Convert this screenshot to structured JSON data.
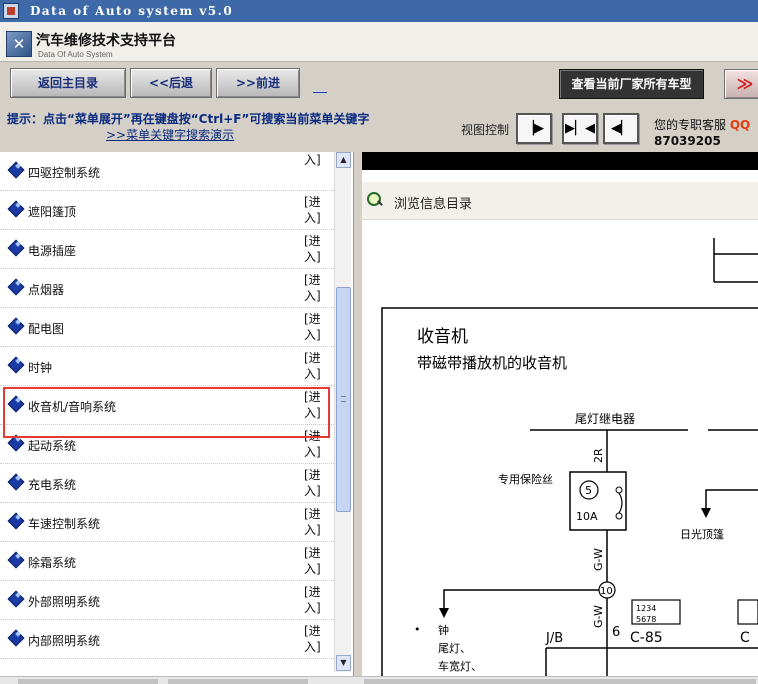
{
  "window": {
    "title": "Data of Auto system v5.0"
  },
  "brand": {
    "name": "汽车维修技术支持平台",
    "subtitle": "Data Of Auto System"
  },
  "toolbar": {
    "home": "返回主目录",
    "back": "<<后退",
    "forward": ">>前进",
    "all_models": "查看当前厂家所有车型",
    "more": "≫"
  },
  "tip": {
    "line1": "提示：点击“菜单展开”再在键盘按“Ctrl+F”可搜索当前菜单关键字",
    "line2": ">>菜单关键字搜索演示",
    "view_label": "视图控制",
    "support_label": "您的专职客服",
    "support_qq": "QQ",
    "support_phone": "87039205"
  },
  "menu": {
    "enter": "[进入]",
    "items": [
      {
        "label": "四驱控制系统"
      },
      {
        "label": "遮阳篷顶"
      },
      {
        "label": "电源插座"
      },
      {
        "label": "点烟器"
      },
      {
        "label": "配电图"
      },
      {
        "label": "时钟"
      },
      {
        "label": "收音机/音响系统",
        "selected": true
      },
      {
        "label": "起动系统"
      },
      {
        "label": "充电系统"
      },
      {
        "label": "车速控制系统"
      },
      {
        "label": "除霜系统"
      },
      {
        "label": "外部照明系统"
      },
      {
        "label": "内部照明系统"
      }
    ]
  },
  "content": {
    "header": "浏览信息目录",
    "diagram": {
      "title": "收音机",
      "subtitle": "带磁带播放机的收音机",
      "relay": "尾灯继电器",
      "fuse_label": "专用保险丝",
      "fuse_num": "5",
      "fuse_amp": "10A",
      "wire_2r": "2R",
      "wire_gw1": "G-W",
      "wire_gw2": "G-W",
      "node_10": "10",
      "node_6": "6",
      "sunroof": "日光顶篷",
      "jb": "J/B",
      "c85": "C-85",
      "c_partial": "C",
      "connector_nums_top": "1234",
      "connector_nums_bottom": "5678",
      "bullet": "•",
      "list_1": "钟",
      "list_2": "尾灯、",
      "list_3": "车宽灯、"
    }
  },
  "colors": {
    "accent": "#3e69a8",
    "highlight": "#e53935",
    "link": "#0a2a80",
    "qq": "#e63a0a"
  }
}
